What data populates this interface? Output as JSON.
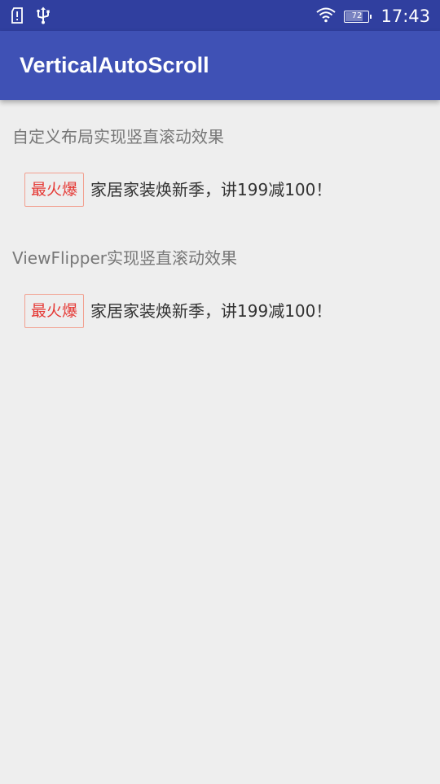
{
  "status_bar": {
    "time": "17:43",
    "battery_level": "72",
    "battery_fraction": 0.72,
    "icons": [
      "sd-card-alert-icon",
      "usb-icon",
      "wifi-icon",
      "battery-icon"
    ]
  },
  "app_bar": {
    "title": "VerticalAutoScroll"
  },
  "sections": [
    {
      "label": "自定义布局实现竖直滚动效果",
      "tag": "最火爆",
      "text": "家居家装焕新季，讲199减100！"
    },
    {
      "label": "ViewFlipper实现竖直滚动效果",
      "tag": "最火爆",
      "text": "家居家装焕新季，讲199减100！"
    }
  ],
  "colors": {
    "status_bar": "#303f9f",
    "app_bar": "#3f51b5",
    "background": "#eeeeee",
    "tag_text": "#e53935",
    "tag_border": "#f2a090",
    "label_text": "#777777",
    "body_text": "#333333"
  }
}
